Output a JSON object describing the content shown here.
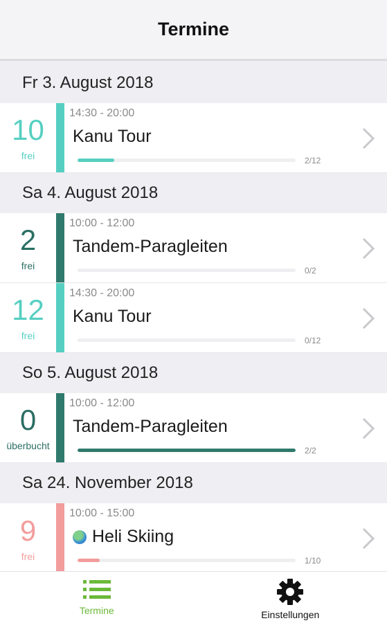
{
  "header": {
    "title": "Termine"
  },
  "days": [
    {
      "date": "Fr 3. August 2018",
      "events": [
        {
          "count": "10",
          "count_label": "frei",
          "time": "14:30 - 20:00",
          "title": "Kanu Tour",
          "ratio": "2/12",
          "fill": 0.167,
          "color": "teal",
          "icon": null
        }
      ]
    },
    {
      "date": "Sa 4. August 2018",
      "events": [
        {
          "count": "2",
          "count_label": "frei",
          "time": "10:00 - 12:00",
          "title": "Tandem-Paragleiten",
          "ratio": "0/2",
          "fill": 0,
          "color": "dark",
          "icon": null
        },
        {
          "count": "12",
          "count_label": "frei",
          "time": "14:30 - 20:00",
          "title": "Kanu Tour",
          "ratio": "0/12",
          "fill": 0,
          "color": "teal",
          "icon": null
        }
      ]
    },
    {
      "date": "So 5. August 2018",
      "events": [
        {
          "count": "0",
          "count_label": "überbucht",
          "time": "10:00 - 12:00",
          "title": "Tandem-Paragleiten",
          "ratio": "2/2",
          "fill": 1.0,
          "color": "dark",
          "icon": null
        }
      ]
    },
    {
      "date": "Sa 24. November 2018",
      "events": [
        {
          "count": "9",
          "count_label": "frei",
          "time": "10:00 - 15:00",
          "title": "Heli Skiing",
          "ratio": "1/10",
          "fill": 0.1,
          "color": "pink",
          "icon": "globe-icon"
        }
      ]
    }
  ],
  "tabbar": {
    "tabs": [
      {
        "label": "Termine",
        "icon": "list-icon",
        "active": true,
        "color": "#6bb93a"
      },
      {
        "label": "Einstellungen",
        "icon": "gear-icon",
        "active": false,
        "color": "#111111"
      }
    ]
  }
}
